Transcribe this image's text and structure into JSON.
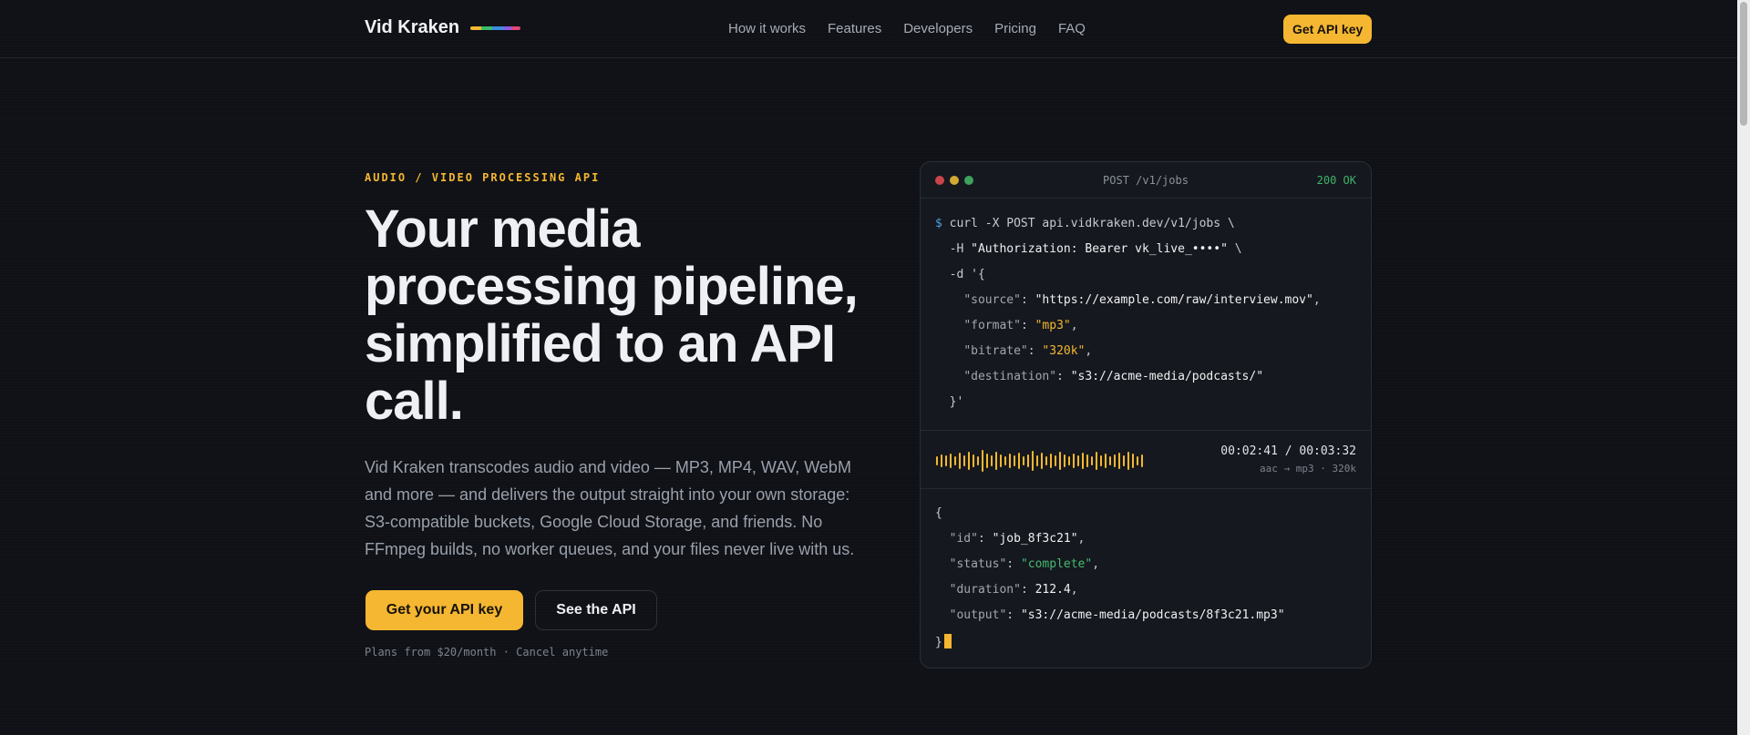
{
  "brand": {
    "name": "Vid Kraken"
  },
  "nav": {
    "items": [
      "How it works",
      "Features",
      "Developers",
      "Pricing",
      "FAQ"
    ]
  },
  "header": {
    "cta_label": "Get API key"
  },
  "hero": {
    "eyebrow": "AUDIO / VIDEO PROCESSING API",
    "title": "Your media processing pipeline, simplified to an API call.",
    "description": "Vid Kraken transcodes audio and video — MP3, MP4, WAV, WebM and more — and delivers the output straight into your own storage: S3-compatible buckets, Google Cloud Storage, and friends. No FFmpeg builds, no worker queues, and your files never live with us.",
    "primary_cta": "Get your API key",
    "secondary_cta": "See the API",
    "plans_note": "Plans from $20/month · Cancel anytime"
  },
  "terminal": {
    "method": "POST /v1/jobs",
    "status": "200 OK",
    "request": {
      "prompt": "$",
      "command": "curl -X POST api.vidkraken.dev/v1/jobs \\",
      "auth_flag": "-H",
      "auth_value": "\"Authorization: Bearer vk_live_••••\"",
      "auth_cont": "\\",
      "data_open": "-d '{",
      "fields": [
        {
          "key": "\"source\"",
          "value": "\"https://example.com/raw/interview.mov\"",
          "trail": ",",
          "accent": "str"
        },
        {
          "key": "\"format\"",
          "value": "\"mp3\"",
          "trail": ",",
          "accent": "amber"
        },
        {
          "key": "\"bitrate\"",
          "value": "\"320k\"",
          "trail": ",",
          "accent": "amber"
        },
        {
          "key": "\"destination\"",
          "value": "\"s3://acme-media/podcasts/\"",
          "trail": "",
          "accent": "str"
        }
      ],
      "data_close": "}'"
    },
    "player": {
      "time": "00:02:41 / 00:03:32",
      "format": "aac → mp3 · 320k",
      "progress_fraction": 0.76
    },
    "response": {
      "open": "{",
      "fields": [
        {
          "key": "\"id\"",
          "value": "\"job_8f3c21\"",
          "trail": ",",
          "accent": "str"
        },
        {
          "key": "\"status\"",
          "value": "\"complete\"",
          "trail": ",",
          "accent": "green"
        },
        {
          "key": "\"duration\"",
          "value": "212.4",
          "trail": ",",
          "accent": "str"
        },
        {
          "key": "\"output\"",
          "value": "\"s3://acme-media/podcasts/8f3c21.mp3\"",
          "trail": "",
          "accent": "str"
        }
      ],
      "close": "}"
    }
  },
  "colors": {
    "accent": "#f5b731",
    "background": "#0f1116",
    "success": "#3fb36b"
  }
}
